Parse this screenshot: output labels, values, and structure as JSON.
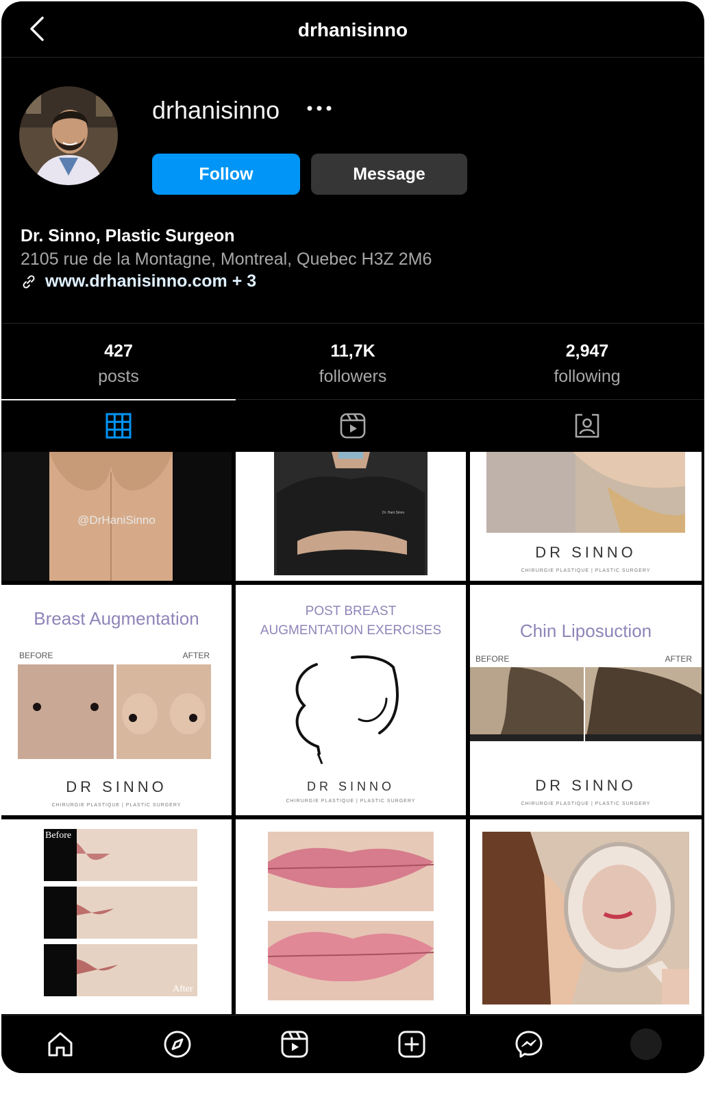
{
  "header": {
    "title": "drhanisinno"
  },
  "profile": {
    "username": "drhanisinno",
    "follow_label": "Follow",
    "message_label": "Message",
    "bio_name": "Dr. Sinno, Plastic Surgeon",
    "bio_address": "2105 rue de la Montagne, Montreal, Quebec H3Z 2M6",
    "bio_link": "www.drhanisinno.com + 3"
  },
  "stats": [
    {
      "value": "427",
      "label": "posts"
    },
    {
      "value": "11,7K",
      "label": "followers"
    },
    {
      "value": "2,947",
      "label": "following"
    }
  ],
  "tabs": [
    "grid-icon",
    "reels-icon",
    "tagged-icon"
  ],
  "posts": {
    "p1_watermark": "@DrHaniSinno",
    "p2_badge": "Dr. Hani Sinno",
    "p3_brand": "DR SINNO",
    "p3_brand_sub": "CHIRURGIE PLASTIQUE | PLASTIC SURGERY",
    "p4_title": "Breast Augmentation",
    "p4_before": "BEFORE",
    "p4_after": "AFTER",
    "p4_brand": "DR SINNO",
    "p4_brand_sub": "CHIRURGIE PLASTIQUE | PLASTIC SURGERY",
    "p5_title_1": "POST BREAST",
    "p5_title_2": "AUGMENTATION EXERCISES",
    "p5_brand": "DR SINNO",
    "p5_brand_sub": "CHIRURGIE PLASTIQUE | PLASTIC SURGERY",
    "p6_title": "Chin Liposuction",
    "p6_before": "BEFORE",
    "p6_after": "AFTER",
    "p6_brand": "DR SINNO",
    "p6_brand_sub": "CHIRURGIE PLASTIQUE | PLASTIC SURGERY",
    "p7_before": "Before",
    "p7_after": "After"
  },
  "colors": {
    "accent": "#0095f6",
    "message_bg": "#363636",
    "background": "#000000",
    "secondary_text": "#a8a8a8",
    "brand_purple": "#8f84b8"
  },
  "nav": [
    "home-icon",
    "explore-icon",
    "reels-icon",
    "new-post-icon",
    "messenger-icon",
    "profile-avatar"
  ]
}
